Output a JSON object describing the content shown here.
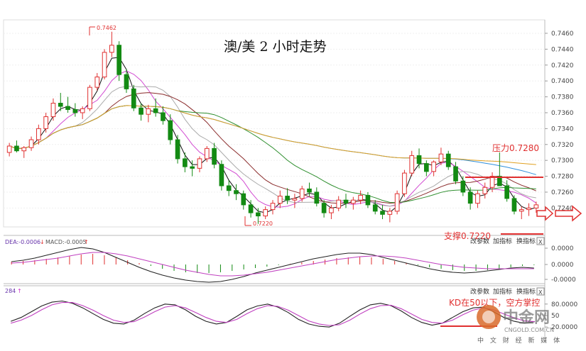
{
  "title": "澳/美 2 小时走势",
  "annotations": {
    "high_label": "0.7462",
    "low_label": "0.7220",
    "pressure": "压力0.7280",
    "support": "支撑0.7220",
    "kd_note": "KD在50以下，空方掌控"
  },
  "macd_indicator": {
    "label_dea": "DEA:-0.0006",
    "label_macd": "MACD:-0.0005",
    "arrow_down": "↓",
    "arrow_up": "↑"
  },
  "kd_indicator": {
    "label": "284",
    "arrow_up": "↑"
  },
  "buttons": {
    "params": "改参数",
    "add": "加指标",
    "replace": "换指标",
    "close": "X"
  },
  "watermark": {
    "name": "中金网",
    "url": "CNGOLD.COM.CN",
    "tagline": "中 文 财 经 新 媒 体"
  },
  "colors": {
    "up": "#e03030",
    "down": "#138a13",
    "pressure_line": "#e03030",
    "ma_black": "#111111",
    "ma_magenta": "#d24bd2",
    "ma_gray": "#aaaaaa",
    "ma_brown": "#8b2c2c",
    "ma_green": "#2f8f2f",
    "ma_blue": "#2f8fdc",
    "ma_orange": "#e0a020"
  },
  "chart_data": [
    {
      "type": "candlestick",
      "title": "澳/美 2 小时走势",
      "y_ticks": [
        "0.7460",
        "0.7440",
        "0.7420",
        "0.7400",
        "0.7380",
        "0.7360",
        "0.7340",
        "0.7320",
        "0.7300",
        "0.7280",
        "0.7260",
        "0.7240"
      ],
      "ylim": [
        0.7218,
        0.7468
      ],
      "levels": {
        "pressure": 0.728,
        "support": 0.722
      },
      "candles": [
        [
          0.731,
          0.7322,
          0.7305,
          0.7318
        ],
        [
          0.7318,
          0.7325,
          0.731,
          0.7312
        ],
        [
          0.7312,
          0.7318,
          0.7303,
          0.7316
        ],
        [
          0.7316,
          0.733,
          0.7312,
          0.7326
        ],
        [
          0.7326,
          0.7345,
          0.732,
          0.734
        ],
        [
          0.734,
          0.736,
          0.7335,
          0.7355
        ],
        [
          0.7355,
          0.7378,
          0.735,
          0.7372
        ],
        [
          0.7372,
          0.7385,
          0.7362,
          0.7368
        ],
        [
          0.7368,
          0.738,
          0.736,
          0.7364
        ],
        [
          0.7364,
          0.7372,
          0.7355,
          0.736
        ],
        [
          0.736,
          0.7368,
          0.7352,
          0.7365
        ],
        [
          0.7365,
          0.7395,
          0.7362,
          0.7392
        ],
        [
          0.7392,
          0.741,
          0.7388,
          0.7405
        ],
        [
          0.7405,
          0.744,
          0.7402,
          0.7436
        ],
        [
          0.7436,
          0.7462,
          0.743,
          0.7445
        ],
        [
          0.7445,
          0.745,
          0.74,
          0.7408
        ],
        [
          0.7408,
          0.7415,
          0.7385,
          0.739
        ],
        [
          0.739,
          0.7395,
          0.7362,
          0.7366
        ],
        [
          0.7366,
          0.7372,
          0.735,
          0.7358
        ],
        [
          0.7358,
          0.737,
          0.7348,
          0.7365
        ],
        [
          0.7365,
          0.7378,
          0.7355,
          0.736
        ],
        [
          0.736,
          0.7368,
          0.7345,
          0.735
        ],
        [
          0.735,
          0.7358,
          0.732,
          0.7326
        ],
        [
          0.7326,
          0.7332,
          0.7296,
          0.7302
        ],
        [
          0.7302,
          0.731,
          0.7285,
          0.7292
        ],
        [
          0.7292,
          0.73,
          0.728,
          0.729
        ],
        [
          0.729,
          0.7305,
          0.7285,
          0.7302
        ],
        [
          0.7302,
          0.7318,
          0.7298,
          0.7315
        ],
        [
          0.7315,
          0.7322,
          0.729,
          0.7295
        ],
        [
          0.7295,
          0.73,
          0.7262,
          0.7268
        ],
        [
          0.7268,
          0.7275,
          0.7255,
          0.7262
        ],
        [
          0.7262,
          0.727,
          0.725,
          0.7258
        ],
        [
          0.7258,
          0.7262,
          0.7238,
          0.7244
        ],
        [
          0.7244,
          0.725,
          0.7228,
          0.7234
        ],
        [
          0.7234,
          0.724,
          0.722,
          0.723
        ],
        [
          0.723,
          0.7242,
          0.7226,
          0.7238
        ],
        [
          0.7238,
          0.725,
          0.7232,
          0.7246
        ],
        [
          0.7246,
          0.7262,
          0.724,
          0.7255
        ],
        [
          0.7255,
          0.7265,
          0.7245,
          0.725
        ],
        [
          0.725,
          0.7258,
          0.724,
          0.7252
        ],
        [
          0.7252,
          0.7268,
          0.7248,
          0.7264
        ],
        [
          0.7264,
          0.7272,
          0.7255,
          0.726
        ],
        [
          0.726,
          0.7266,
          0.7242,
          0.7246
        ],
        [
          0.7246,
          0.725,
          0.7228,
          0.7234
        ],
        [
          0.7234,
          0.7244,
          0.7226,
          0.724
        ],
        [
          0.724,
          0.7255,
          0.7236,
          0.725
        ],
        [
          0.725,
          0.7258,
          0.724,
          0.7246
        ],
        [
          0.7246,
          0.7254,
          0.7238,
          0.725
        ],
        [
          0.725,
          0.7262,
          0.7245,
          0.7256
        ],
        [
          0.7256,
          0.726,
          0.724,
          0.7244
        ],
        [
          0.7244,
          0.725,
          0.7232,
          0.7236
        ],
        [
          0.7236,
          0.7244,
          0.7226,
          0.7232
        ],
        [
          0.7232,
          0.724,
          0.7222,
          0.7236
        ],
        [
          0.7236,
          0.7262,
          0.7232,
          0.7258
        ],
        [
          0.7258,
          0.7288,
          0.7254,
          0.7284
        ],
        [
          0.7284,
          0.7312,
          0.728,
          0.7306
        ],
        [
          0.7306,
          0.7315,
          0.729,
          0.7296
        ],
        [
          0.7296,
          0.73,
          0.728,
          0.7286
        ],
        [
          0.7286,
          0.73,
          0.728,
          0.7298
        ],
        [
          0.7298,
          0.7316,
          0.7294,
          0.7308
        ],
        [
          0.7308,
          0.7312,
          0.7288,
          0.7292
        ],
        [
          0.7292,
          0.7298,
          0.727,
          0.7274
        ],
        [
          0.7274,
          0.728,
          0.7255,
          0.726
        ],
        [
          0.726,
          0.7266,
          0.7238,
          0.7246
        ],
        [
          0.7246,
          0.7262,
          0.724,
          0.7258
        ],
        [
          0.7258,
          0.7272,
          0.7252,
          0.7266
        ],
        [
          0.7266,
          0.7285,
          0.726,
          0.728
        ],
        [
          0.728,
          0.731,
          0.7276,
          0.7268
        ],
        [
          0.7268,
          0.7275,
          0.7248,
          0.7252
        ],
        [
          0.7252,
          0.7256,
          0.7232,
          0.7236
        ],
        [
          0.7236,
          0.7242,
          0.7226,
          0.7238
        ],
        [
          0.7238,
          0.7246,
          0.723,
          0.724
        ],
        [
          0.724,
          0.7248,
          0.7234,
          0.7244
        ]
      ]
    },
    {
      "type": "macd",
      "y_ticks": [
        "0.0000",
        "0.0000",
        "-0.0000"
      ],
      "histogram": [
        0.0004,
        0.0005,
        0.0006,
        0.0008,
        0.001,
        0.0012,
        0.0014,
        0.0015,
        0.0013,
        0.001,
        0.0006,
        0.0002,
        -0.0002,
        -0.0006,
        -0.0009,
        -0.0011,
        -0.0012,
        -0.0012,
        -0.0011,
        -0.0009,
        -0.0007,
        -0.0005,
        -0.0003,
        -0.0001,
        0.0001,
        0.0003,
        0.0005,
        0.0007,
        0.0009,
        0.001,
        0.0011,
        0.001,
        0.0008,
        0.0005,
        0.0002,
        -0.0001,
        -0.0004,
        -0.0006,
        -0.0008,
        -0.0009,
        -0.0009,
        -0.0008,
        -0.0006,
        -0.0004,
        -0.0002,
        -0.0001
      ],
      "dif": [
        0.0004,
        0.0006,
        0.0009,
        0.0013,
        0.0017,
        0.0021,
        0.0024,
        0.0022,
        0.0017,
        0.001,
        0.0003,
        -0.0004,
        -0.001,
        -0.0015,
        -0.0019,
        -0.0022,
        -0.0024,
        -0.0025,
        -0.0024,
        -0.0021,
        -0.0017,
        -0.0012,
        -0.0008,
        -0.0004,
        0.0,
        0.0004,
        0.0008,
        0.0011,
        0.0014,
        0.0016,
        0.0016,
        0.0014,
        0.001,
        0.0006,
        0.0002,
        -0.0002,
        -0.0006,
        -0.0009,
        -0.0011,
        -0.0012,
        -0.0011,
        -0.0009,
        -0.0007,
        -0.0005,
        -0.0004,
        -0.0005
      ],
      "dea": [
        0.0002,
        0.0003,
        0.0005,
        0.0007,
        0.0009,
        0.0012,
        0.0015,
        0.0017,
        0.0017,
        0.0015,
        0.0012,
        0.0008,
        0.0004,
        0.0,
        -0.0004,
        -0.0008,
        -0.0011,
        -0.0014,
        -0.0016,
        -0.0016,
        -0.0015,
        -0.0013,
        -0.0011,
        -0.0008,
        -0.0005,
        -0.0002,
        0.0001,
        0.0004,
        0.0007,
        0.0009,
        0.0011,
        0.0012,
        0.0012,
        0.0011,
        0.0009,
        0.0006,
        0.0003,
        0.0,
        -0.0002,
        -0.0004,
        -0.0005,
        -0.0006,
        -0.0006,
        -0.0006,
        -0.0006,
        -0.0006
      ]
    },
    {
      "type": "line",
      "y_ticks": [
        "80.0000",
        "50",
        "20.0000"
      ],
      "k": [
        35,
        45,
        60,
        75,
        85,
        88,
        82,
        70,
        55,
        40,
        30,
        28,
        38,
        55,
        70,
        80,
        78,
        65,
        48,
        35,
        28,
        32,
        48,
        65,
        75,
        80,
        72,
        58,
        40,
        28,
        22,
        20,
        30,
        48,
        65,
        78,
        82,
        76,
        62,
        45,
        32,
        25,
        30,
        45,
        60,
        70,
        72,
        60,
        45,
        35,
        30,
        34
      ],
      "d": [
        30,
        38,
        50,
        65,
        78,
        84,
        84,
        76,
        64,
        50,
        38,
        32,
        34,
        46,
        60,
        72,
        76,
        70,
        58,
        45,
        35,
        32,
        40,
        55,
        68,
        76,
        74,
        64,
        50,
        36,
        28,
        24,
        26,
        38,
        54,
        68,
        76,
        77,
        68,
        54,
        40,
        32,
        30,
        38,
        52,
        64,
        70,
        65,
        54,
        44,
        36,
        34
      ]
    }
  ]
}
